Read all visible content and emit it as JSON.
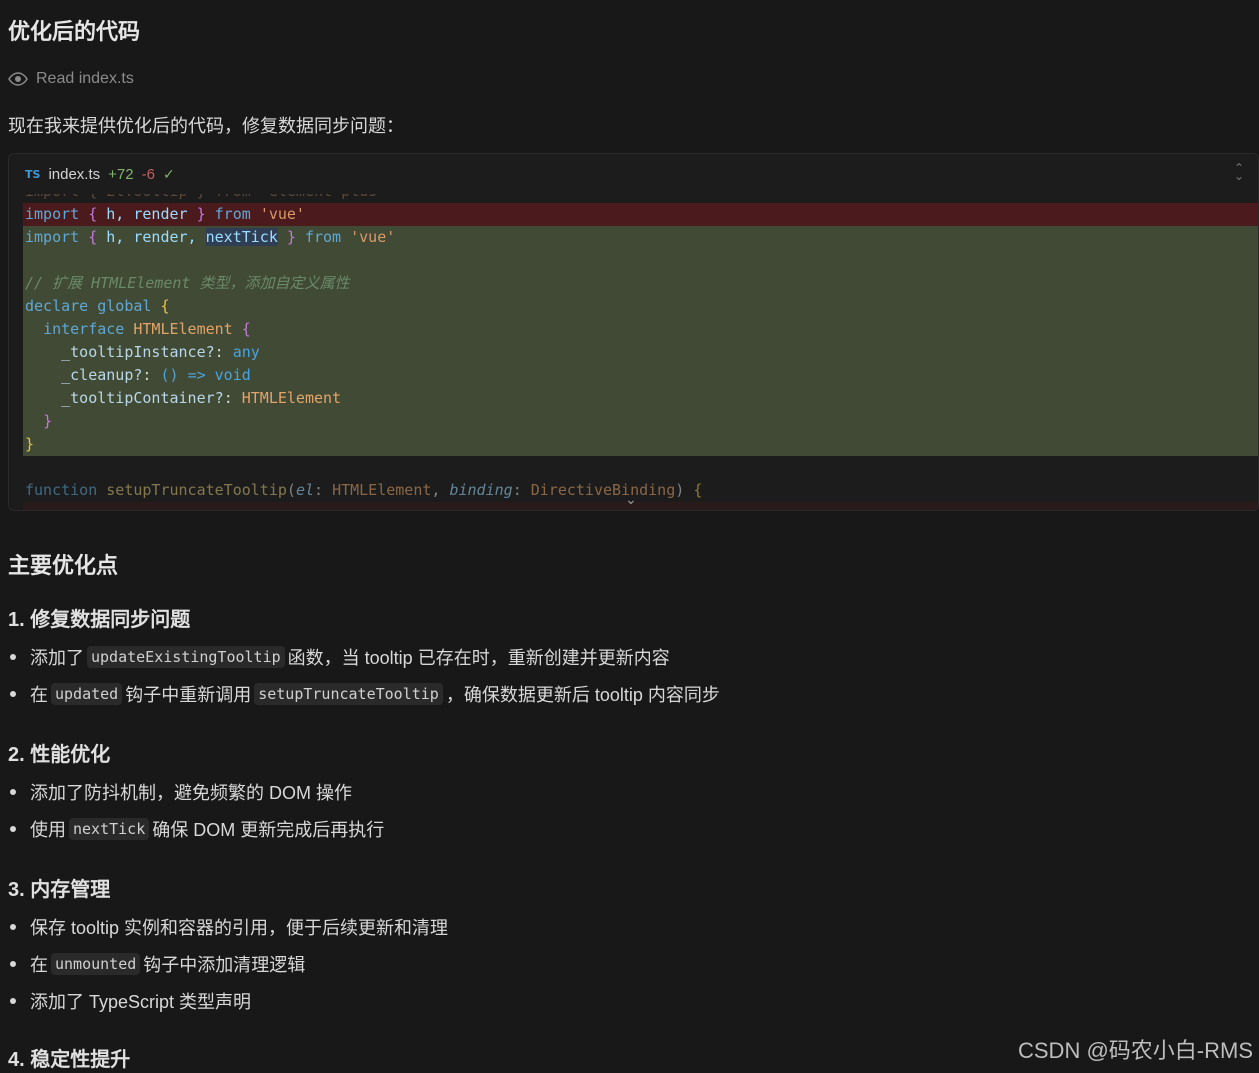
{
  "title": "优化后的代码",
  "read_action": "Read index.ts",
  "intro": "现在我来提供优化后的代码，修复数据同步问题：",
  "code_card": {
    "lang_badge": "TS",
    "filename": "index.ts",
    "additions": "+72",
    "deletions": "-6",
    "check": "✓"
  },
  "code_lines": {
    "l0": "import { ElTooltip } from 'element-plus'",
    "l1_a": "import",
    "l1_b": "{",
    "l1_c": "h, render",
    "l1_d": "}",
    "l1_e": "from",
    "l1_f": "'vue'",
    "l2_a": "import",
    "l2_b": "{",
    "l2_c": "h, render, ",
    "l2_d": "nextTick",
    "l2_e": "}",
    "l2_f": "from",
    "l2_g": "'vue'",
    "l4": "// 扩展 HTMLElement 类型，添加自定义属性",
    "l5_a": "declare",
    "l5_b": "global",
    "l5_c": "{",
    "l6_a": "interface",
    "l6_b": "HTMLElement",
    "l6_c": "{",
    "l7_a": "_tooltipInstance?",
    "l7_b": ":",
    "l7_c": "any",
    "l8_a": "_cleanup?",
    "l8_b": ":",
    "l8_c": "()",
    "l8_d": "=>",
    "l8_e": "void",
    "l9_a": "_tooltipContainer?",
    "l9_b": ":",
    "l9_c": "HTMLElement",
    "l10": "}",
    "l11": "}",
    "l13_a": "function",
    "l13_b": "setupTruncateTooltip",
    "l13_c": "el",
    "l13_d": "HTMLElement",
    "l13_e": "binding",
    "l13_f": "DirectiveBinding",
    "l13_g": "{"
  },
  "section_heading": "主要优化点",
  "groups": [
    {
      "heading": "1. 修复数据同步问题",
      "b1_pre": "添加了",
      "b1_code": "updateExistingTooltip",
      "b1_post": "函数，当 tooltip 已存在时，重新创建并更新内容",
      "b2_pre": "在",
      "b2_code": "updated",
      "b2_mid": "钩子中重新调用",
      "b2_code2": "setupTruncateTooltip",
      "b2_post": "，确保数据更新后 tooltip 内容同步"
    },
    {
      "heading": "2. 性能优化",
      "b1": "添加了防抖机制，避免频繁的 DOM 操作",
      "b2_pre": "使用",
      "b2_code": "nextTick",
      "b2_post": "确保 DOM 更新完成后再执行"
    },
    {
      "heading": "3. 内存管理",
      "b1": "保存 tooltip 实例和容器的引用，便于后续更新和清理",
      "b2_pre": "在",
      "b2_code": "unmounted",
      "b2_post": "钩子中添加清理逻辑",
      "b3": "添加了 TypeScript 类型声明"
    },
    {
      "heading": "4. 稳定性提升"
    }
  ],
  "watermark": "CSDN @码农小白-RMS"
}
